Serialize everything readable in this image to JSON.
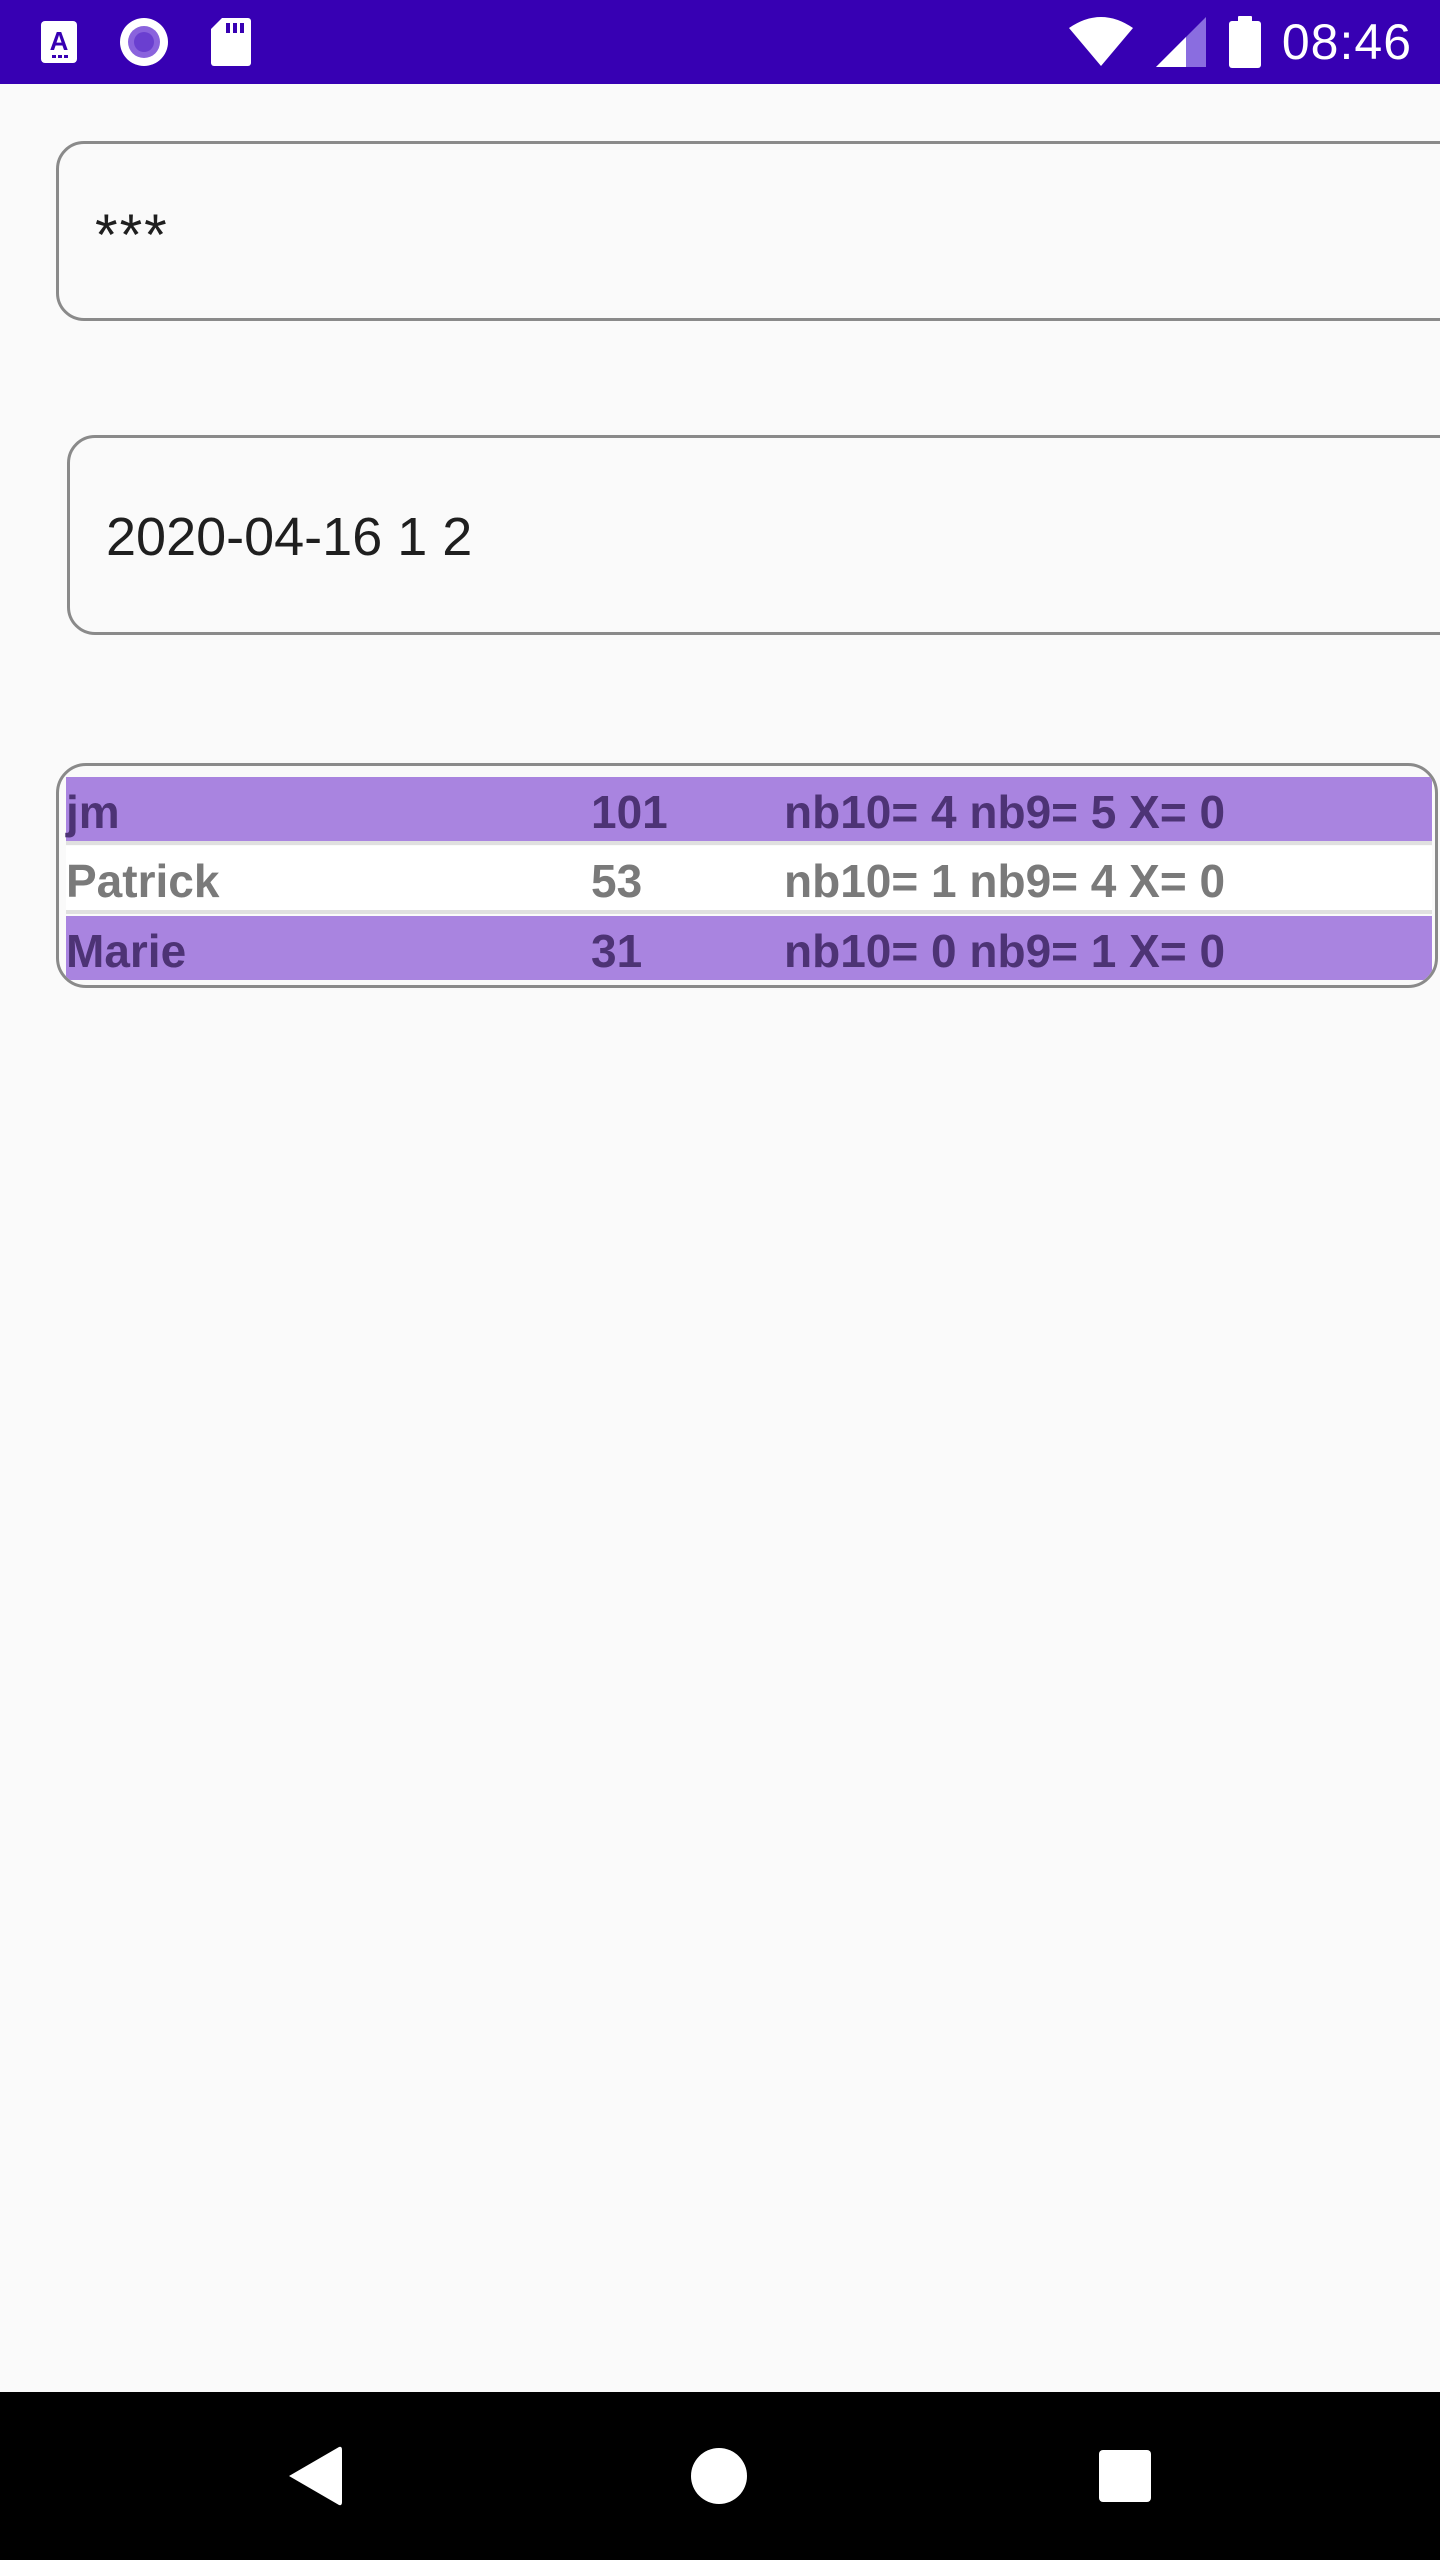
{
  "status_bar": {
    "time": "08:46",
    "left_icons": [
      "accessibility-a-icon",
      "record-circle-icon",
      "sd-card-icon"
    ],
    "right_icons": [
      "wifi-icon",
      "cell-signal-icon",
      "battery-icon"
    ],
    "background_color": "#3700b3"
  },
  "fields": {
    "password_value": "***",
    "date_value": "2020-04-16 1 2"
  },
  "scores": {
    "highlight_color": "#a984e0",
    "rows": [
      {
        "name": "jm",
        "score": "101",
        "stats": "nb10= 4 nb9= 5 X= 0"
      },
      {
        "name": "Patrick",
        "score": "53",
        "stats": "nb10= 1 nb9= 4 X= 0"
      },
      {
        "name": "Marie",
        "score": "31",
        "stats": "nb10= 0 nb9= 1 X= 0"
      }
    ]
  },
  "nav_bar": {
    "buttons": [
      "back-icon",
      "home-icon",
      "recents-icon"
    ]
  }
}
